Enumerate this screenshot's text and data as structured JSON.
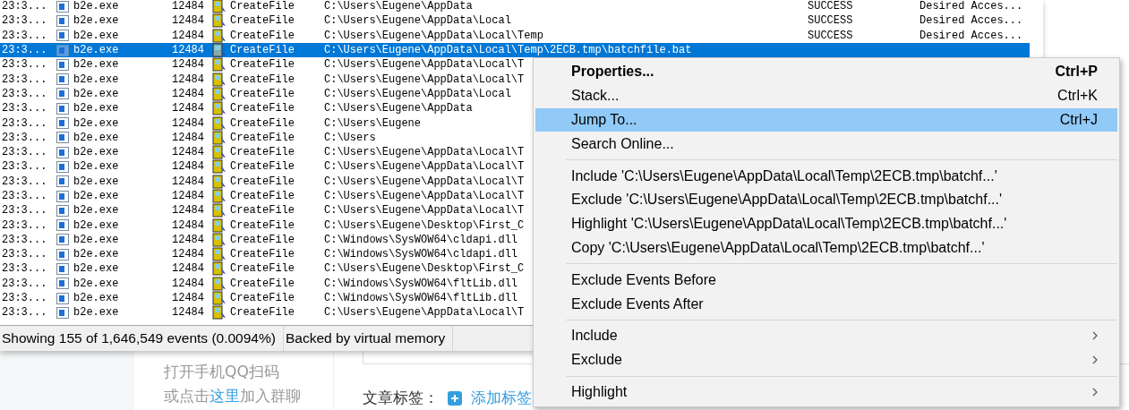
{
  "event_list": {
    "rows": [
      {
        "time": "23:3...",
        "process": "b2e.exe",
        "pid": "12484",
        "operation": "CreateFile",
        "path": "C:\\Users\\Eugene\\AppData",
        "result": "SUCCESS",
        "detail": "Desired Acces...",
        "selected": false
      },
      {
        "time": "23:3...",
        "process": "b2e.exe",
        "pid": "12484",
        "operation": "CreateFile",
        "path": "C:\\Users\\Eugene\\AppData\\Local",
        "result": "SUCCESS",
        "detail": "Desired Acces...",
        "selected": false
      },
      {
        "time": "23:3...",
        "process": "b2e.exe",
        "pid": "12484",
        "operation": "CreateFile",
        "path": "C:\\Users\\Eugene\\AppData\\Local\\Temp",
        "result": "SUCCESS",
        "detail": "Desired Acces...",
        "selected": false
      },
      {
        "time": "23:3...",
        "process": "b2e.exe",
        "pid": "12484",
        "operation": "CreateFile",
        "path": "C:\\Users\\Eugene\\AppData\\Local\\Temp\\2ECB.tmp\\batchfile.bat",
        "selected": true
      },
      {
        "time": "23:3...",
        "process": "b2e.exe",
        "pid": "12484",
        "operation": "CreateFile",
        "path": "C:\\Users\\Eugene\\AppData\\Local\\T",
        "selected": false
      },
      {
        "time": "23:3...",
        "process": "b2e.exe",
        "pid": "12484",
        "operation": "CreateFile",
        "path": "C:\\Users\\Eugene\\AppData\\Local\\T",
        "selected": false
      },
      {
        "time": "23:3...",
        "process": "b2e.exe",
        "pid": "12484",
        "operation": "CreateFile",
        "path": "C:\\Users\\Eugene\\AppData\\Local",
        "selected": false
      },
      {
        "time": "23:3...",
        "process": "b2e.exe",
        "pid": "12484",
        "operation": "CreateFile",
        "path": "C:\\Users\\Eugene\\AppData",
        "selected": false
      },
      {
        "time": "23:3...",
        "process": "b2e.exe",
        "pid": "12484",
        "operation": "CreateFile",
        "path": "C:\\Users\\Eugene",
        "selected": false
      },
      {
        "time": "23:3...",
        "process": "b2e.exe",
        "pid": "12484",
        "operation": "CreateFile",
        "path": "C:\\Users",
        "selected": false
      },
      {
        "time": "23:3...",
        "process": "b2e.exe",
        "pid": "12484",
        "operation": "CreateFile",
        "path": "C:\\Users\\Eugene\\AppData\\Local\\T",
        "selected": false
      },
      {
        "time": "23:3...",
        "process": "b2e.exe",
        "pid": "12484",
        "operation": "CreateFile",
        "path": "C:\\Users\\Eugene\\AppData\\Local\\T",
        "selected": false
      },
      {
        "time": "23:3...",
        "process": "b2e.exe",
        "pid": "12484",
        "operation": "CreateFile",
        "path": "C:\\Users\\Eugene\\AppData\\Local\\T",
        "selected": false
      },
      {
        "time": "23:3...",
        "process": "b2e.exe",
        "pid": "12484",
        "operation": "CreateFile",
        "path": "C:\\Users\\Eugene\\AppData\\Local\\T",
        "selected": false
      },
      {
        "time": "23:3...",
        "process": "b2e.exe",
        "pid": "12484",
        "operation": "CreateFile",
        "path": "C:\\Users\\Eugene\\AppData\\Local\\T",
        "selected": false
      },
      {
        "time": "23:3...",
        "process": "b2e.exe",
        "pid": "12484",
        "operation": "CreateFile",
        "path": "C:\\Users\\Eugene\\Desktop\\First_C",
        "selected": false
      },
      {
        "time": "23:3...",
        "process": "b2e.exe",
        "pid": "12484",
        "operation": "CreateFile",
        "path": "C:\\Windows\\SysWOW64\\cldapi.dll",
        "selected": false
      },
      {
        "time": "23:3...",
        "process": "b2e.exe",
        "pid": "12484",
        "operation": "CreateFile",
        "path": "C:\\Windows\\SysWOW64\\cldapi.dll",
        "selected": false
      },
      {
        "time": "23:3...",
        "process": "b2e.exe",
        "pid": "12484",
        "operation": "CreateFile",
        "path": "C:\\Users\\Eugene\\Desktop\\First_C",
        "selected": false
      },
      {
        "time": "23:3...",
        "process": "b2e.exe",
        "pid": "12484",
        "operation": "CreateFile",
        "path": "C:\\Windows\\SysWOW64\\fltLib.dll",
        "selected": false
      },
      {
        "time": "23:3...",
        "process": "b2e.exe",
        "pid": "12484",
        "operation": "CreateFile",
        "path": "C:\\Windows\\SysWOW64\\fltLib.dll",
        "selected": false
      },
      {
        "time": "23:3...",
        "process": "b2e.exe",
        "pid": "12484",
        "operation": "CreateFile",
        "path": "C:\\Users\\Eugene\\AppData\\Local\\T",
        "selected": false
      }
    ]
  },
  "status_bar": [
    "Showing 155 of 1,646,549 events (0.0094%)",
    "Backed by virtual memory"
  ],
  "background_page": {
    "qr_lines": [
      "打开手机QQ扫码"
    ],
    "join_prefix": "或点击",
    "join_link": "这里",
    "join_suffix": "加入群聊",
    "tags_label": "文章标签：",
    "add_tag": "添加标签"
  },
  "context_menu": [
    {
      "kind": "item",
      "label": "Properties...",
      "shortcut": "Ctrl+P",
      "default": true,
      "selected": false
    },
    {
      "kind": "item",
      "label": "Stack...",
      "shortcut": "Ctrl+K",
      "default": false,
      "selected": false
    },
    {
      "kind": "item",
      "label": "Jump To...",
      "shortcut": "Ctrl+J",
      "default": false,
      "selected": true
    },
    {
      "kind": "item",
      "label": "Search Online...",
      "default": false,
      "selected": false
    },
    {
      "kind": "separator"
    },
    {
      "kind": "item",
      "label": "Include 'C:\\Users\\Eugene\\AppData\\Local\\Temp\\2ECB.tmp\\batchf...'",
      "default": false,
      "selected": false
    },
    {
      "kind": "item",
      "label": "Exclude 'C:\\Users\\Eugene\\AppData\\Local\\Temp\\2ECB.tmp\\batchf...'",
      "default": false,
      "selected": false
    },
    {
      "kind": "item",
      "label": "Highlight 'C:\\Users\\Eugene\\AppData\\Local\\Temp\\2ECB.tmp\\batchf...'",
      "default": false,
      "selected": false
    },
    {
      "kind": "item",
      "label": "Copy 'C:\\Users\\Eugene\\AppData\\Local\\Temp\\2ECB.tmp\\batchf...'",
      "default": false,
      "selected": false
    },
    {
      "kind": "separator"
    },
    {
      "kind": "item",
      "label": "Exclude Events Before",
      "default": false,
      "selected": false
    },
    {
      "kind": "item",
      "label": "Exclude Events After",
      "default": false,
      "selected": false
    },
    {
      "kind": "separator"
    },
    {
      "kind": "submenu",
      "label": "Include",
      "default": false,
      "selected": false
    },
    {
      "kind": "submenu",
      "label": "Exclude",
      "default": false,
      "selected": false
    },
    {
      "kind": "separator"
    },
    {
      "kind": "submenu",
      "label": "Highlight",
      "default": false,
      "selected": false
    }
  ]
}
